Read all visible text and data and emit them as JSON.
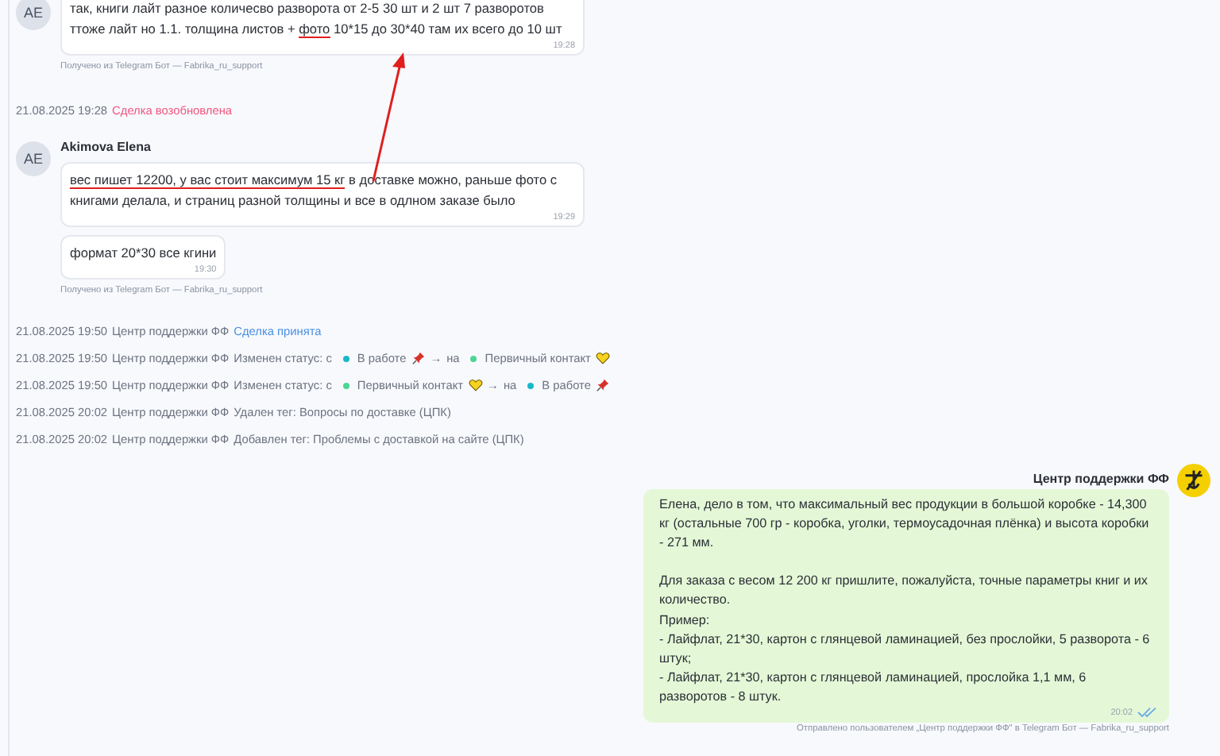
{
  "feed": [
    {
      "kind": "incoming",
      "initials": "AE",
      "messages": [
        {
          "segments": [
            {
              "text": "так, книги лайт разное количесво разворота от 2-5 30 шт и 2 шт 7 разворотов ттоже лайт но 1.1. толщина листов + ",
              "underlined": false
            },
            {
              "text": "фото",
              "underlined": true
            },
            {
              "text": " 10*15 до 30*40 там их всего до 10 шт",
              "underlined": false
            }
          ],
          "time": "19:28"
        }
      ],
      "source": "Получено из Telegram Бот — Fabrika_ru_support"
    },
    {
      "kind": "deal",
      "date": "21.08.2025 19:28",
      "text": "Сделка возобновлена",
      "color": "#f0567f"
    },
    {
      "kind": "incoming",
      "initials": "AE",
      "author": "Akimova Elena",
      "messages": [
        {
          "segments": [
            {
              "text": "вес пишет 12200, у вас стоит максимум 15 кг",
              "underlined": true
            },
            {
              "text": " в доставке можно, раньше фото с книгами делала, и страниц разной толщины и все в одлном заказе было",
              "underlined": false
            }
          ],
          "time": "19:29"
        },
        {
          "segments": [
            {
              "text": "формат 20*30 все кгини",
              "underlined": false
            }
          ],
          "time": "19:30"
        }
      ],
      "source": "Получено из Telegram Бот — Fabrika_ru_support"
    },
    {
      "kind": "deal",
      "date": "21.08.2025 19:50",
      "author": "Центр поддержки ФФ",
      "text": "Сделка принята",
      "color": "#4a90e2"
    },
    {
      "kind": "status",
      "date": "21.08.2025 19:50",
      "author": "Центр поддержки ФФ",
      "action": "Изменен статус: с",
      "from": {
        "label": "В работе",
        "color": "#17b8c9",
        "kind": "pin"
      },
      "arrow": "→",
      "joiner": "на",
      "to": {
        "label": "Первичный контакт",
        "color": "#4cd694",
        "kind": "heart"
      }
    },
    {
      "kind": "status",
      "date": "21.08.2025 19:50",
      "author": "Центр поддержки ФФ",
      "action": "Изменен статус: с",
      "from": {
        "label": "Первичный контакт",
        "color": "#4cd694",
        "kind": "heart"
      },
      "arrow": "→",
      "joiner": "на",
      "to": {
        "label": "В работе",
        "color": "#17b8c9",
        "kind": "pin"
      }
    },
    {
      "kind": "tag",
      "date": "21.08.2025 20:02",
      "author": "Центр поддержки ФФ",
      "text": "Удален тег: Вопросы по доставке (ЦПК)"
    },
    {
      "kind": "tag",
      "date": "21.08.2025 20:02",
      "author": "Центр поддержки ФФ",
      "text": "Добавлен тег: Проблемы с доставкой на сайте (ЦПК)"
    },
    {
      "kind": "outgoing",
      "author": "Центр поддержки ФФ",
      "text": "Елена, дело в том, что максимальный вес продукции в большой коробке - 14,300 кг (остальные 700 гр - коробка, уголки, термоусадочная плёнка) и высота коробки - 271 мм.\n\nДля заказа с весом 12 200 кг пришлите, пожалуйста, точные параметры книг и их количество.\nПример:\n- Лайфлат, 21*30, картон с глянцевой ламинацией, без прослойки, 5 разворота - 6 штук;\n- Лайфлат, 21*30, картон с глянцевой ламинацией, прослойка 1,1 мм, 6 разворотов - 8 штук.",
      "time": "20:02",
      "read": true,
      "source": "Отправлено пользователем „Центр поддержки ФФ\" в Telegram Бот — Fabrika_ru_support"
    }
  ]
}
